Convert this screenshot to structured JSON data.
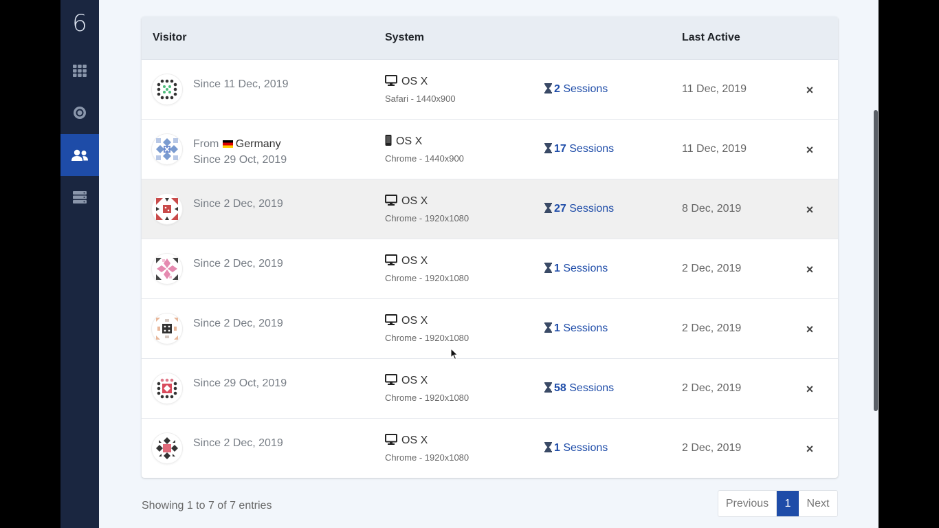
{
  "sidebar": {
    "logo": "6",
    "items": [
      {
        "icon": "grid-icon",
        "active": false
      },
      {
        "icon": "target-icon",
        "active": false
      },
      {
        "icon": "users-icon",
        "active": true
      },
      {
        "icon": "server-icon",
        "active": false
      }
    ]
  },
  "table": {
    "headers": {
      "visitor": "Visitor",
      "system": "System",
      "last_active": "Last Active"
    },
    "rows": [
      {
        "since": "Since 11 Dec, 2019",
        "from": "",
        "country": "",
        "os": "OS X",
        "device": "desktop",
        "browser": "Safari - 1440x900",
        "sessions_count": "2",
        "sessions_label": "Sessions",
        "last_active": "11 Dec, 2019"
      },
      {
        "since": "Since 29 Oct, 2019",
        "from": "From",
        "country": "Germany",
        "os": "OS X",
        "device": "mobile",
        "browser": "Chrome - 1440x900",
        "sessions_count": "17",
        "sessions_label": "Sessions",
        "last_active": "11 Dec, 2019"
      },
      {
        "since": "Since 2 Dec, 2019",
        "from": "",
        "country": "",
        "os": "OS X",
        "device": "desktop",
        "browser": "Chrome - 1920x1080",
        "sessions_count": "27",
        "sessions_label": "Sessions",
        "last_active": "8 Dec, 2019"
      },
      {
        "since": "Since 2 Dec, 2019",
        "from": "",
        "country": "",
        "os": "OS X",
        "device": "desktop",
        "browser": "Chrome - 1920x1080",
        "sessions_count": "1",
        "sessions_label": "Sessions",
        "last_active": "2 Dec, 2019"
      },
      {
        "since": "Since 2 Dec, 2019",
        "from": "",
        "country": "",
        "os": "OS X",
        "device": "desktop",
        "browser": "Chrome - 1920x1080",
        "sessions_count": "1",
        "sessions_label": "Sessions",
        "last_active": "2 Dec, 2019"
      },
      {
        "since": "Since 29 Oct, 2019",
        "from": "",
        "country": "",
        "os": "OS X",
        "device": "desktop",
        "browser": "Chrome - 1920x1080",
        "sessions_count": "58",
        "sessions_label": "Sessions",
        "last_active": "2 Dec, 2019"
      },
      {
        "since": "Since 2 Dec, 2019",
        "from": "",
        "country": "",
        "os": "OS X",
        "device": "desktop",
        "browser": "Chrome - 1920x1080",
        "sessions_count": "1",
        "sessions_label": "Sessions",
        "last_active": "2 Dec, 2019"
      }
    ],
    "delete_glyph": "×"
  },
  "footer": {
    "showing": "Showing 1 to 7 of 7 entries",
    "previous": "Previous",
    "page": "1",
    "next": "Next"
  },
  "colors": {
    "accent": "#1e4ca8",
    "sidebar_bg": "#1a2640",
    "page_bg": "#f2f6fb"
  }
}
